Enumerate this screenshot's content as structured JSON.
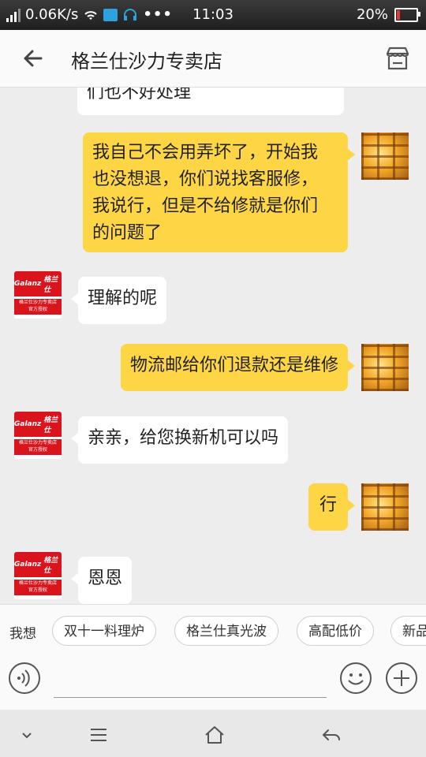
{
  "status_bar": {
    "network_speed": "0.06K/s",
    "time": "11:03",
    "battery_percent": "20%",
    "battery_level": 0.2,
    "overflow_dots": "•••"
  },
  "header": {
    "title": "格兰仕沙力专卖店",
    "back_icon": "arrow-left-icon",
    "store_icon": "storefront-icon"
  },
  "store_avatar": {
    "brand": "Galanz",
    "brand_cn": "格兰仕",
    "line1": "格兰仕沙力专卖店",
    "line2": "官方授权"
  },
  "messages": [
    {
      "side": "in",
      "text": "们也不好处理"
    },
    {
      "side": "out",
      "lines": [
        "我自己不会用弄坏了，开始我",
        "也没想退，你们说找客服修，",
        "我说行，但是不给修就是你们",
        "的问题了"
      ]
    },
    {
      "side": "in",
      "text": "理解的呢"
    },
    {
      "side": "out",
      "text": "物流邮给你们退款还是维修"
    },
    {
      "side": "in",
      "text": "亲亲，给您换新机可以吗"
    },
    {
      "side": "out",
      "text": "行"
    },
    {
      "side": "in",
      "text": "恩恩"
    }
  ],
  "quick_replies": {
    "label": "我想",
    "chips": [
      "双十一料理炉",
      "格兰仕真光波",
      "高配低价",
      "新品"
    ]
  },
  "input_bar": {
    "voice_icon": "voice-icon",
    "emoji_icon": "emoji-icon",
    "plus_icon": "plus-icon",
    "value": ""
  },
  "nav_bar": {
    "icons": [
      "chevron-down-icon",
      "menu-icon",
      "home-icon",
      "back-icon"
    ]
  },
  "colors": {
    "outgoing_bubble": "#fdd545",
    "incoming_bubble": "#ffffff",
    "background": "#ededed",
    "brand_red": "#d9141c"
  }
}
